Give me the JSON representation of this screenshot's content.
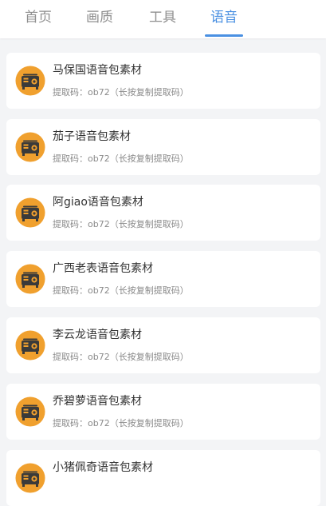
{
  "tabs": [
    {
      "label": "首页",
      "active": false
    },
    {
      "label": "画质",
      "active": false
    },
    {
      "label": "工具",
      "active": false
    },
    {
      "label": "语音",
      "active": true
    }
  ],
  "icon": "radio-icon",
  "colors": {
    "accent": "#4a90e2",
    "icon_orange": "#f0a02e",
    "icon_dark": "#3a3a3a"
  },
  "items": [
    {
      "title": "马保国语音包素材",
      "code": "提取码：ob72（长按复制提取码）"
    },
    {
      "title": "茄子语音包素材",
      "code": "提取码：ob72（长按复制提取码）"
    },
    {
      "title": "阿giao语音包素材",
      "code": "提取码：ob72（长按复制提取码）"
    },
    {
      "title": "广西老表语音包素材",
      "code": "提取码：ob72（长按复制提取码）"
    },
    {
      "title": "李云龙语音包素材",
      "code": "提取码：ob72（长按复制提取码）"
    },
    {
      "title": "乔碧萝语音包素材",
      "code": "提取码：ob72（长按复制提取码）"
    },
    {
      "title": "小猪佩奇语音包素材",
      "code": ""
    }
  ]
}
